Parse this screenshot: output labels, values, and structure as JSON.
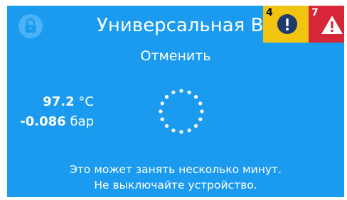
{
  "header": {
    "title": "Универсальная В",
    "info_badge": {
      "count": "4",
      "icon": "exclamation-circle-icon",
      "color": "#f1c40f"
    },
    "alert_badge": {
      "count": "7",
      "icon": "warning-triangle-icon",
      "color": "#d72638"
    },
    "lock_icon": "lock-icon"
  },
  "actions": {
    "cancel_label": "Отменить"
  },
  "readings": {
    "temperature_value": "97.2",
    "temperature_unit": "°C",
    "pressure_value": "-0.086",
    "pressure_unit": "бар"
  },
  "status": {
    "line1": "Это может занять несколько минут.",
    "line2": "Не выключайте устройство."
  },
  "colors": {
    "background": "#1a9bf0",
    "text": "#ffffff"
  }
}
